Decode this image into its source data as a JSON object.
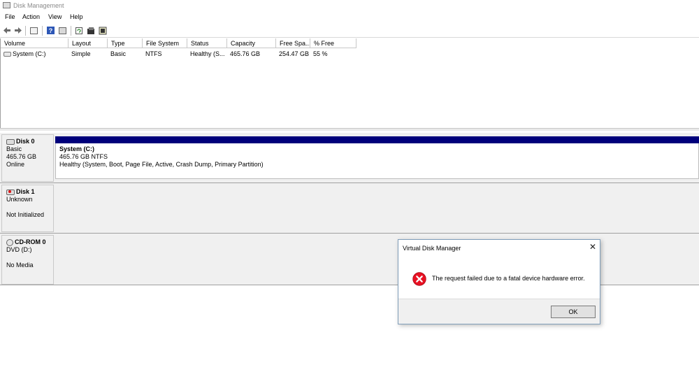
{
  "window": {
    "title": "Disk Management"
  },
  "menu": [
    "File",
    "Action",
    "View",
    "Help"
  ],
  "toolbar": {
    "icons": [
      "back-arrow-icon",
      "forward-arrow-icon",
      "console-tree-icon",
      "help-icon",
      "console-icon",
      "refresh-icon",
      "properties-icon",
      "disk-view-icon"
    ]
  },
  "volume_list": {
    "columns": [
      "Volume",
      "Layout",
      "Type",
      "File System",
      "Status",
      "Capacity",
      "Free Spa...",
      "% Free"
    ],
    "rows": [
      {
        "volume": "System (C:)",
        "layout": "Simple",
        "type": "Basic",
        "file_system": "NTFS",
        "status": "Healthy (S...",
        "capacity": "465.76 GB",
        "free_space": "254.47 GB",
        "pct_free": "55 %"
      }
    ]
  },
  "disks": [
    {
      "name": "Disk 0",
      "type": "Basic",
      "size": "465.76 GB",
      "status": "Online"
    },
    {
      "name": "Disk 1",
      "type": "Unknown",
      "size": "",
      "status": "Not Initialized"
    },
    {
      "name": "CD-ROM 0",
      "type": "DVD (D:)",
      "size": "",
      "status": "No Media"
    }
  ],
  "partition": {
    "name": "System  (C:)",
    "size_fs": "465.76 GB NTFS",
    "status": "Healthy (System, Boot, Page File, Active, Crash Dump, Primary Partition)",
    "color": "#00007b"
  },
  "dialog": {
    "title": "Virtual Disk Manager",
    "message": "The request failed due to a fatal device hardware error.",
    "ok_label": "OK",
    "close_symbol": "✕",
    "icon": "error-icon",
    "icon_color": "#e81123"
  }
}
